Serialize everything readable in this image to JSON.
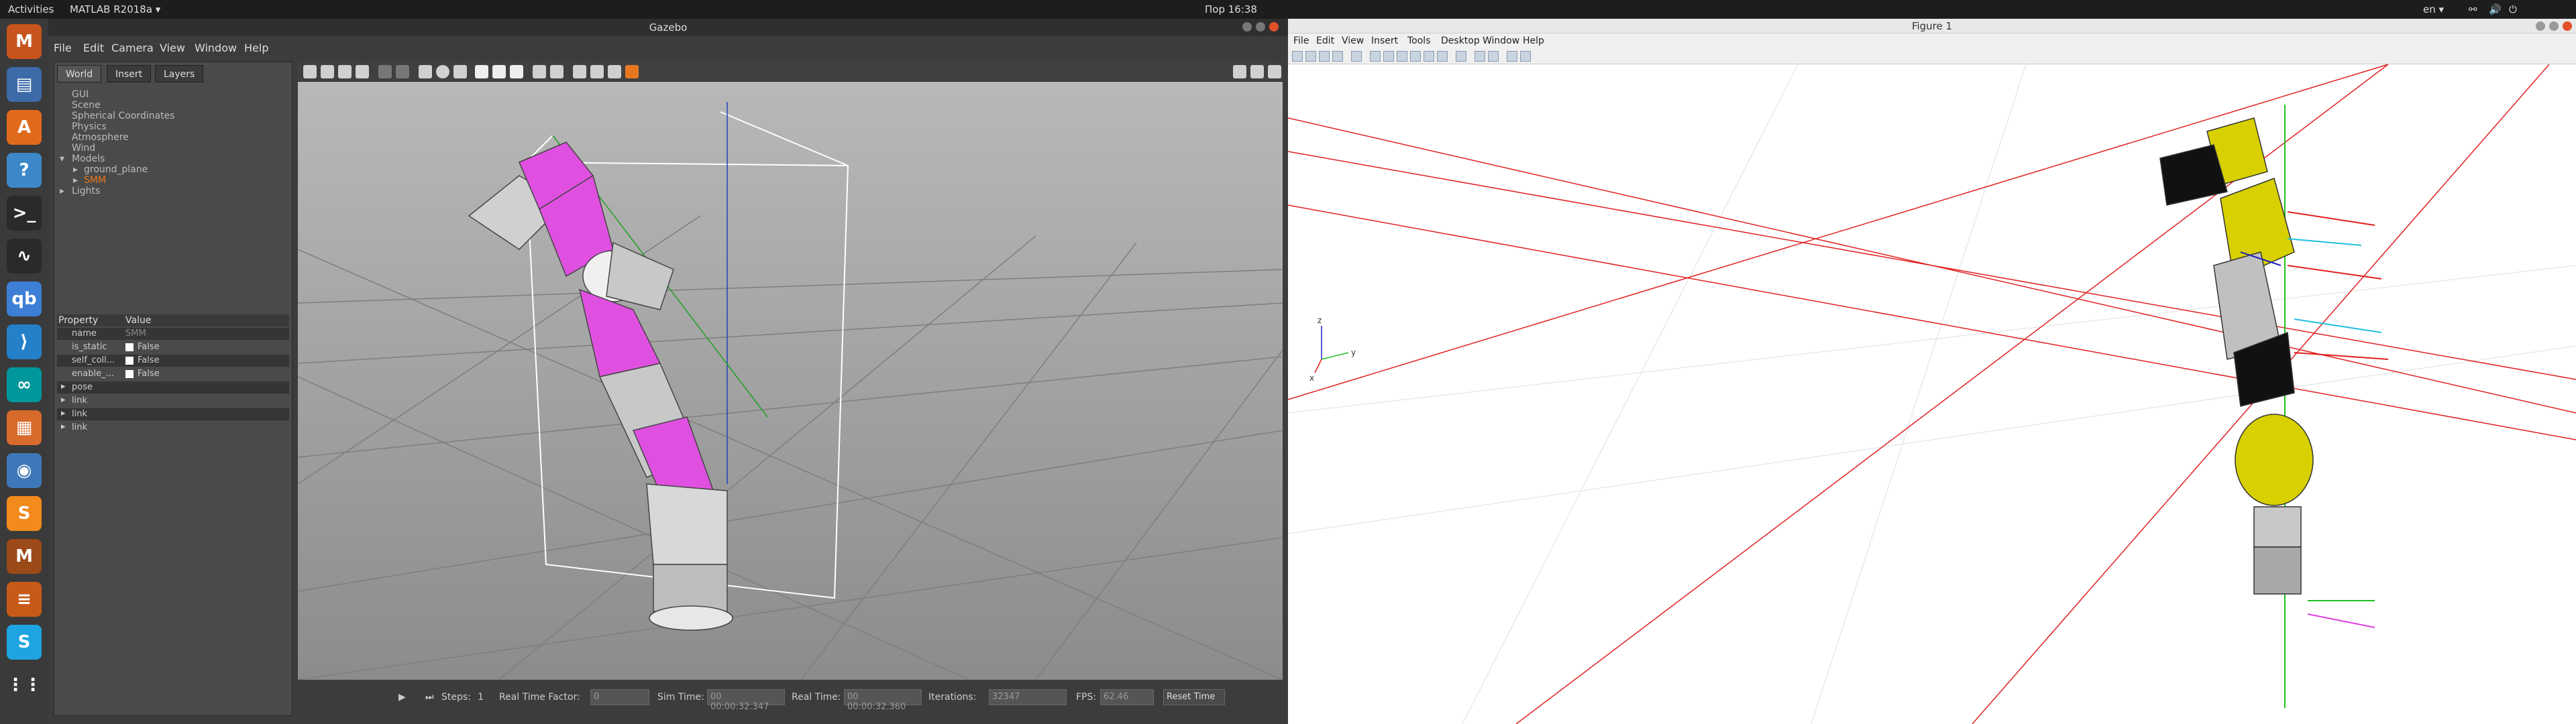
{
  "topbar": {
    "activities": "Activities",
    "app": "MATLAB R2018a ▾",
    "clock": "Пор 16:38",
    "lang": "en ▾"
  },
  "dock": [
    {
      "name": "matlab-icon",
      "glyph": "M",
      "color": "#c7541c"
    },
    {
      "name": "files-icon",
      "glyph": "▤",
      "color": "#3d6aa8"
    },
    {
      "name": "software-icon",
      "glyph": "A",
      "color": "#e06a1c"
    },
    {
      "name": "help-icon",
      "glyph": "?",
      "color": "#3c88c8"
    },
    {
      "name": "terminal-icon",
      "glyph": ">_",
      "color": "#2a2a2a"
    },
    {
      "name": "monitor-icon",
      "glyph": "∿",
      "color": "#2a2a2a"
    },
    {
      "name": "qbittorrent-icon",
      "glyph": "qb",
      "color": "#3d7fd6"
    },
    {
      "name": "vscode-icon",
      "glyph": "⟩",
      "color": "#2480c8"
    },
    {
      "name": "arduino-icon",
      "glyph": "∞",
      "color": "#00979c"
    },
    {
      "name": "calculator-icon",
      "glyph": "▦",
      "color": "#d86a2c"
    },
    {
      "name": "remmina-icon",
      "glyph": "◉",
      "color": "#3f78b8"
    },
    {
      "name": "sublime-icon",
      "glyph": "S",
      "color": "#f28a1c"
    },
    {
      "name": "matlab2-icon",
      "glyph": "M",
      "color": "#9c4a18"
    },
    {
      "name": "stack-icon",
      "glyph": "≡",
      "color": "#c85a18"
    },
    {
      "name": "skype-icon",
      "glyph": "S",
      "color": "#1ea4e0"
    },
    {
      "name": "apps-grid-icon",
      "glyph": "⋮⋮",
      "color": "#3a3a3a"
    }
  ],
  "gazebo": {
    "title": "Gazebo",
    "menu": [
      "File",
      "Edit",
      "Camera",
      "View",
      "Window",
      "Help"
    ],
    "tabs": [
      "World",
      "Insert",
      "Layers"
    ],
    "tree": [
      "GUI",
      "Scene",
      "Spherical Coordinates",
      "Physics",
      "Atmosphere",
      "Wind",
      "Models",
      "ground_plane",
      "SMM",
      "Lights"
    ],
    "props_header": [
      "Property",
      "Value"
    ],
    "props": [
      [
        "name",
        "SMM"
      ],
      [
        "is_static",
        "False"
      ],
      [
        "self_coll...",
        "False"
      ],
      [
        "enable_...",
        "False"
      ],
      [
        "pose",
        ""
      ],
      [
        "link",
        ""
      ],
      [
        "link",
        ""
      ],
      [
        "link",
        ""
      ]
    ],
    "bottom": {
      "steps_label": "Steps:",
      "steps_value": "1",
      "rtf_label": "Real Time Factor:",
      "rtf_value": "0",
      "sim_label": "Sim Time:",
      "sim_value": "00 00:00:32.347",
      "real_label": "Real Time:",
      "real_value": "00 00:00:32.360",
      "iter_label": "Iterations:",
      "iter_value": "32347",
      "fps_label": "FPS:",
      "fps_value": "62.46",
      "reset": "Reset Time"
    }
  },
  "figure": {
    "title": "Figure 1",
    "menu": [
      "File",
      "Edit",
      "View",
      "Insert",
      "Tools",
      "Desktop",
      "Window",
      "Help"
    ],
    "axis_labels": {
      "x": "x",
      "y": "y",
      "z": "z"
    }
  },
  "colors": {
    "accent_magenta": "#e040e0",
    "yellow_parts": "#d8d000",
    "red_lines": "#e02020",
    "gazebo_orange": "#e87820"
  }
}
